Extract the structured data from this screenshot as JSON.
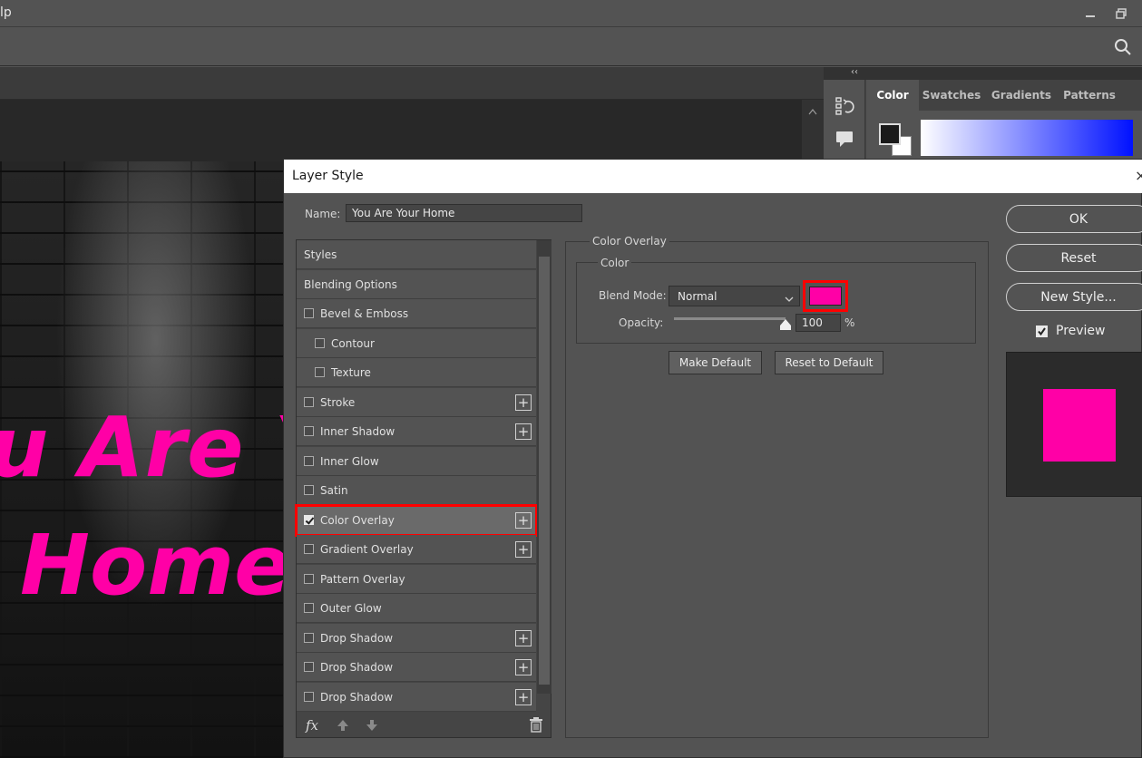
{
  "app": {
    "menu_tail": "lp",
    "window_controls": [
      "minimize-icon",
      "restore-icon"
    ],
    "search_icon": "search-icon"
  },
  "artwork": {
    "line1": "u Are Yo",
    "line2": "Home"
  },
  "panels": {
    "tabs": [
      {
        "label": "Color",
        "active": true
      },
      {
        "label": "Swatches",
        "active": false
      },
      {
        "label": "Gradients",
        "active": false
      },
      {
        "label": "Patterns",
        "active": false
      }
    ],
    "collapse_glyph": "‹‹"
  },
  "dialog": {
    "title": "Layer Style",
    "close_glyph": "×",
    "name_label": "Name:",
    "name_value": "You Are Your  Home",
    "styles": [
      {
        "label": "Styles",
        "kind": "header"
      },
      {
        "label": "Blending Options",
        "kind": "header"
      },
      {
        "label": "Bevel & Emboss",
        "checked": false,
        "plus": false
      },
      {
        "label": "Contour",
        "checked": false,
        "plus": false,
        "indent": true
      },
      {
        "label": "Texture",
        "checked": false,
        "plus": false,
        "indent": true
      },
      {
        "label": "Stroke",
        "checked": false,
        "plus": true
      },
      {
        "label": "Inner Shadow",
        "checked": false,
        "plus": true
      },
      {
        "label": "Inner Glow",
        "checked": false,
        "plus": false
      },
      {
        "label": "Satin",
        "checked": false,
        "plus": false
      },
      {
        "label": "Color Overlay",
        "checked": true,
        "plus": true,
        "selected": true
      },
      {
        "label": "Gradient Overlay",
        "checked": false,
        "plus": true
      },
      {
        "label": "Pattern Overlay",
        "checked": false,
        "plus": false
      },
      {
        "label": "Outer Glow",
        "checked": false,
        "plus": false
      },
      {
        "label": "Drop Shadow",
        "checked": false,
        "plus": true
      },
      {
        "label": "Drop Shadow",
        "checked": false,
        "plus": true
      },
      {
        "label": "Drop Shadow",
        "checked": false,
        "plus": true
      }
    ],
    "footer": {
      "fx_label": "fx",
      "icons": [
        "move-up-icon",
        "move-down-icon",
        "trash-icon"
      ]
    },
    "overlay": {
      "section_title": "Color Overlay",
      "group_title": "Color",
      "blend_mode_label": "Blend Mode:",
      "blend_mode_value": "Normal",
      "overlay_color": "#ff00a6",
      "opacity_label": "Opacity:",
      "opacity_value": "100",
      "opacity_unit": "%",
      "opacity_fraction": 1.0,
      "make_default_label": "Make Default",
      "reset_default_label": "Reset to Default"
    },
    "buttons": {
      "ok": "OK",
      "reset": "Reset",
      "new_style": "New Style...",
      "preview_label": "Preview",
      "preview_checked": true
    }
  },
  "colors": {
    "highlight": "#ff0000",
    "overlay": "#ff00a6",
    "dialog_bg": "#535353"
  }
}
